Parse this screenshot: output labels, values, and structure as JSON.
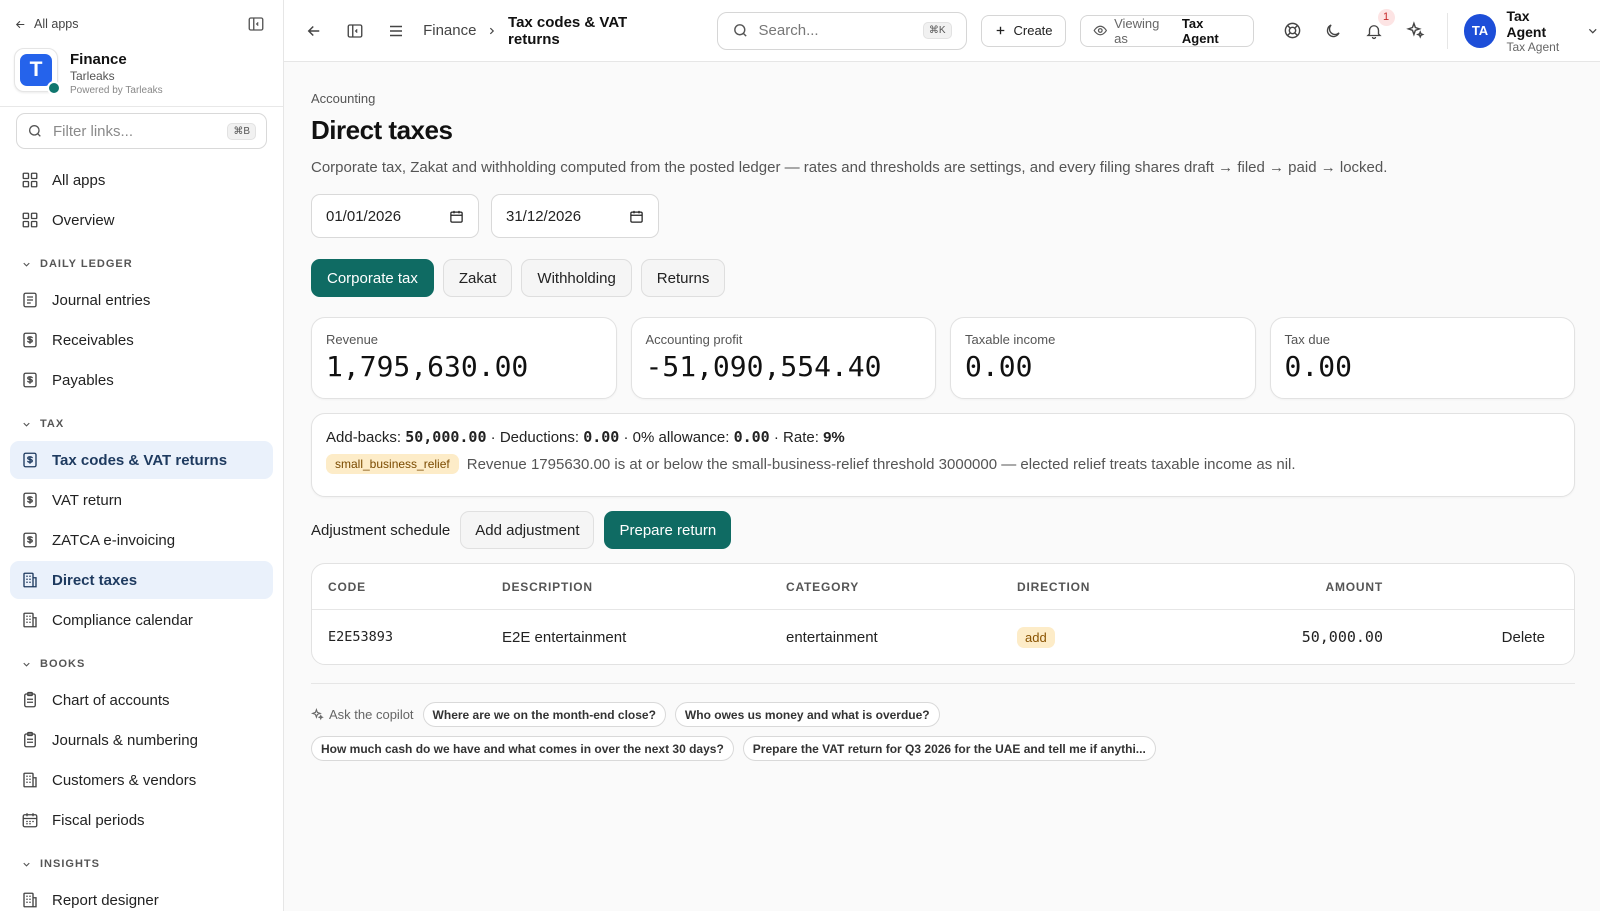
{
  "sidebar": {
    "all_apps": "All apps",
    "org_name": "Finance",
    "org_sub": "Tarleaks",
    "org_powered": "Powered by Tarleaks",
    "logo_letter": "T",
    "filter_placeholder": "Filter links...",
    "filter_shortcut": "⌘B",
    "top_items": [
      {
        "label": "All apps",
        "icon": "grid-icon"
      },
      {
        "label": "Overview",
        "icon": "grid-icon"
      }
    ],
    "sections": [
      {
        "title": "DAILY LEDGER",
        "items": [
          {
            "label": "Journal entries",
            "icon": "ledger-icon"
          },
          {
            "label": "Receivables",
            "icon": "receipt-icon"
          },
          {
            "label": "Payables",
            "icon": "receipt-icon"
          }
        ]
      },
      {
        "title": "TAX",
        "items": [
          {
            "label": "Tax codes & VAT returns",
            "icon": "receipt-icon",
            "active": true
          },
          {
            "label": "VAT return",
            "icon": "receipt-icon"
          },
          {
            "label": "ZATCA e-invoicing",
            "icon": "receipt-icon"
          },
          {
            "label": "Direct taxes",
            "icon": "building-icon",
            "active": true
          },
          {
            "label": "Compliance calendar",
            "icon": "building-icon"
          }
        ]
      },
      {
        "title": "BOOKS",
        "items": [
          {
            "label": "Chart of accounts",
            "icon": "clipboard-icon"
          },
          {
            "label": "Journals & numbering",
            "icon": "clipboard-icon"
          },
          {
            "label": "Customers & vendors",
            "icon": "building-icon"
          },
          {
            "label": "Fiscal periods",
            "icon": "calendar-icon"
          }
        ]
      },
      {
        "title": "INSIGHTS",
        "items": [
          {
            "label": "Report designer",
            "icon": "building-icon"
          }
        ]
      }
    ]
  },
  "topbar": {
    "crumb_parent": "Finance",
    "crumb_current": "Tax codes & VAT returns",
    "search_placeholder": "Search...",
    "search_shortcut": "⌘K",
    "create_label": "Create",
    "viewing_label": "Viewing as",
    "viewing_value": "Tax Agent",
    "notification_count": "1",
    "user_initials": "TA",
    "user_name": "Tax Agent",
    "user_role": "Tax Agent"
  },
  "page": {
    "breadcrumb": "Accounting",
    "title": "Direct taxes",
    "description": "Corporate tax, Zakat and withholding computed from the posted ledger — rates and thresholds are settings, and every filing shares draft → filed → paid → locked.",
    "date_from": "01/01/2026",
    "date_to": "31/12/2026",
    "tabs": [
      "Corporate tax",
      "Zakat",
      "Withholding",
      "Returns"
    ],
    "active_tab": "Corporate tax",
    "kpis": [
      {
        "label": "Revenue",
        "value": "1,795,630.00"
      },
      {
        "label": "Accounting profit",
        "value": "-51,090,554.40"
      },
      {
        "label": "Taxable income",
        "value": "0.00"
      },
      {
        "label": "Tax due",
        "value": "0.00"
      }
    ],
    "summary": {
      "addbacks_label": "Add-backs:",
      "addbacks_value": "50,000.00",
      "deductions_label": "· Deductions:",
      "deductions_value": "0.00",
      "allowance_label": "· 0% allowance:",
      "allowance_value": "0.00",
      "rate_label": "· Rate:",
      "rate_value": "9%",
      "relief_tag": "small_business_relief",
      "relief_text": "Revenue 1795630.00 is at or below the small-business-relief threshold 3000000 — elected relief treats taxable income as nil."
    },
    "adjustments": {
      "label": "Adjustment schedule",
      "add_label": "Add adjustment",
      "prepare_label": "Prepare return",
      "columns": [
        "CODE",
        "DESCRIPTION",
        "CATEGORY",
        "DIRECTION",
        "AMOUNT"
      ],
      "rows": [
        {
          "code": "E2E53893",
          "description": "E2E entertainment",
          "category": "entertainment",
          "direction": "add",
          "amount": "50,000.00",
          "action": "Delete"
        }
      ]
    },
    "copilot": {
      "label": "Ask the copilot",
      "prompts": [
        "Where are we on the month-end close?",
        "Who owes us money and what is overdue?",
        "How much cash do we have and what comes in over the next 30 days?",
        "Prepare the VAT return for Q3 2026 for the UAE and tell me if anythi..."
      ]
    }
  },
  "colors": {
    "accent": "#0f6b63",
    "avatar": "#1d4ed8",
    "active_nav_bg": "#eaf1fb",
    "tag_bg": "#fdecc8"
  }
}
